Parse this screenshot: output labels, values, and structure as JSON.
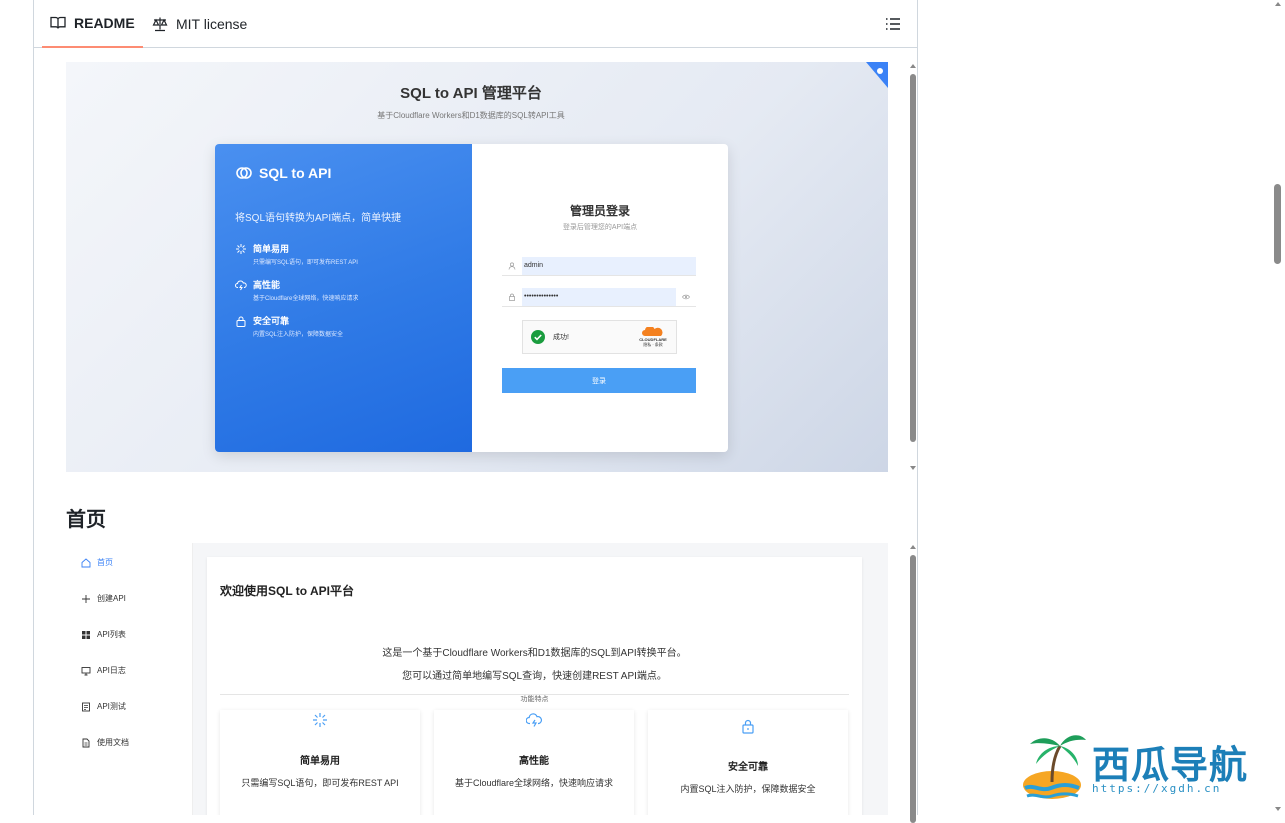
{
  "tabs": {
    "readme": "README",
    "license": "MIT license"
  },
  "login_shot": {
    "title": "SQL to API 管理平台",
    "subtitle": "基于Cloudflare Workers和D1数据库的SQL转API工具",
    "brand": "SQL to API",
    "tagline": "将SQL语句转换为API端点，简单快捷",
    "features": [
      {
        "title": "简单易用",
        "desc": "只需编写SQL语句，即可发布REST API",
        "icon": "sparkle-icon"
      },
      {
        "title": "高性能",
        "desc": "基于Cloudflare全球网络，快速响应请求",
        "icon": "cloud-bolt-icon"
      },
      {
        "title": "安全可靠",
        "desc": "内置SQL注入防护，保障数据安全",
        "icon": "lock-icon"
      }
    ],
    "form_title": "管理员登录",
    "form_subtitle": "登录后管理您的API端点",
    "username": "admin",
    "password": "••••••••••••••",
    "captcha_status": "成功!",
    "captcha_brand": "CLOUDFLARE",
    "captcha_links": "隐私 · 条款",
    "login_button": "登录"
  },
  "heading": "首页",
  "dashboard_shot": {
    "nav": [
      {
        "label": "首页",
        "icon": "home-icon",
        "active": true
      },
      {
        "label": "创建API",
        "icon": "plus-icon",
        "active": false
      },
      {
        "label": "API列表",
        "icon": "grid-icon",
        "active": false
      },
      {
        "label": "API日志",
        "icon": "monitor-icon",
        "active": false
      },
      {
        "label": "API测试",
        "icon": "document-icon",
        "active": false
      },
      {
        "label": "使用文档",
        "icon": "file-icon",
        "active": false
      }
    ],
    "welcome": "欢迎使用SQL to API平台",
    "intro_line1": "这是一个基于Cloudflare Workers和D1数据库的SQL到API转换平台。",
    "intro_line2": "您可以通过简单地编写SQL查询，快速创建REST API端点。",
    "features_label": "功能特点",
    "cards": [
      {
        "title": "简单易用",
        "desc": "只需编写SQL语句，即可发布REST API",
        "icon": "sparkle-icon"
      },
      {
        "title": "高性能",
        "desc": "基于Cloudflare全球网络，快速响应请求",
        "icon": "cloud-bolt-icon"
      },
      {
        "title": "安全可靠",
        "desc": "内置SQL注入防护，保障数据安全",
        "icon": "lock-icon"
      }
    ]
  },
  "watermark": {
    "text": "西瓜导航",
    "url": "https://xgdh.cn"
  },
  "colors": {
    "accent_blue": "#2f7ae6",
    "tab_underline": "#fd8c73",
    "button_blue": "#4a9ff5",
    "success_green": "#1a9c3e",
    "cloudflare_orange": "#f48120"
  }
}
